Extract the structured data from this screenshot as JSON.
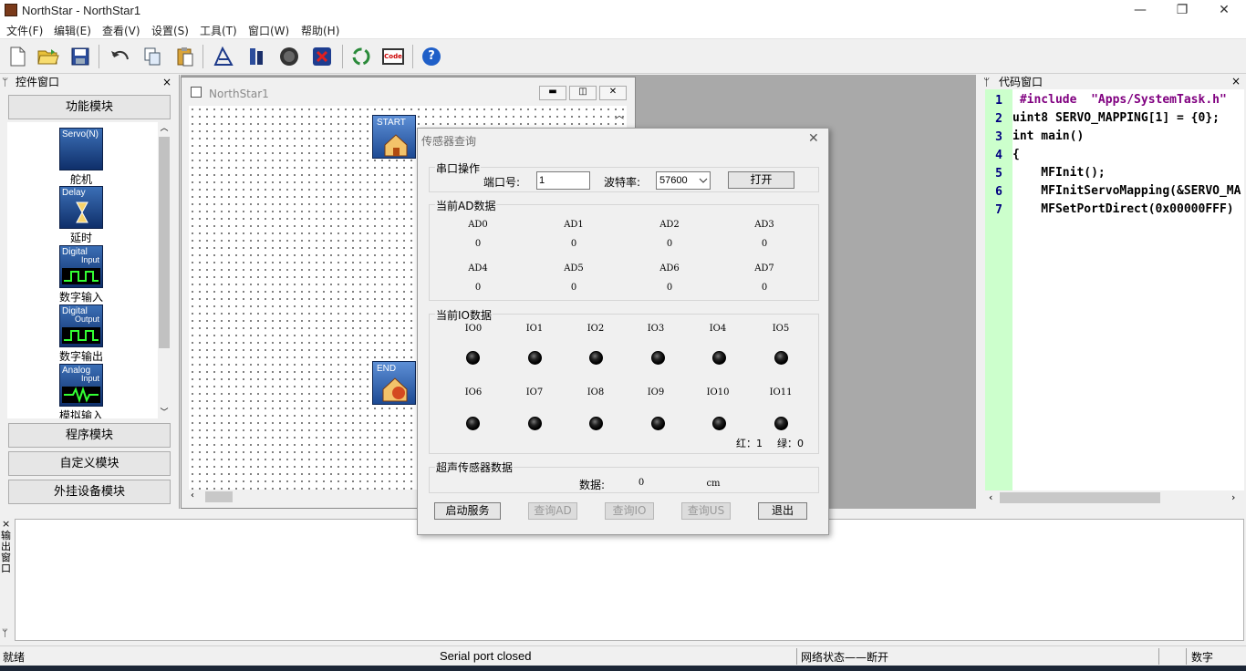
{
  "window": {
    "title": "NorthStar - NorthStar1",
    "minimize": "—",
    "restore": "❐",
    "close": "✕"
  },
  "menu": [
    "文件(F)",
    "编辑(E)",
    "查看(V)",
    "设置(S)",
    "工具(T)",
    "窗口(W)",
    "帮助(H)"
  ],
  "toolbar": {
    "icons": [
      "new-file-icon",
      "open-folder-icon",
      "save-icon",
      "undo-icon",
      "copy-icon",
      "paste-icon",
      "compile-icon",
      "build-icon",
      "run-icon",
      "stop-icon",
      "recycle-icon",
      "code-icon",
      "help-icon"
    ],
    "code_label": "Code",
    "help_label": "?"
  },
  "left_panel": {
    "title": "控件窗口",
    "pin": "ᛘ",
    "close": "×",
    "groups": {
      "function": "功能模块",
      "program": "程序模块",
      "custom": "自定义模块",
      "external": "外挂设备模块"
    },
    "items": [
      {
        "label": "舵机",
        "t1": "Servo(N)",
        "t2": ""
      },
      {
        "label": "延时",
        "t1": "Delay",
        "t2": ""
      },
      {
        "label": "数字输入",
        "t1": "Digital",
        "t2": "Input"
      },
      {
        "label": "数字输出",
        "t1": "Digital",
        "t2": "Output"
      },
      {
        "label": "模拟输入",
        "t1": "Analog",
        "t2": "Input"
      }
    ]
  },
  "child_window": {
    "title": "NorthStar1",
    "start": "START",
    "end": "END"
  },
  "code_panel": {
    "title": "代码窗口",
    "pin": "ᛘ",
    "close": "×",
    "lines": [
      {
        "n": "1",
        "text": " #include  \"Apps/SystemTask.h\""
      },
      {
        "n": "2",
        "text": "uint8 SERVO_MAPPING[1] = {0};"
      },
      {
        "n": "3",
        "text": "int main()"
      },
      {
        "n": "4",
        "text": "{"
      },
      {
        "n": "5",
        "text": "    MFInit();"
      },
      {
        "n": "6",
        "text": "    MFInitServoMapping(&SERVO_MA"
      },
      {
        "n": "7",
        "text": "    MFSetPortDirect(0x00000FFF)"
      }
    ]
  },
  "output_panel": {
    "title": "输出窗口",
    "close": "×",
    "pin": "ᛘ"
  },
  "status": {
    "left": "就绪",
    "serial": "Serial port closed",
    "network": "网络状态——断开",
    "mode": "数字"
  },
  "dialog": {
    "title": "传感器查询",
    "close": "✕",
    "serial": {
      "group": "串口操作",
      "port_label": "端口号:",
      "port_value": "1",
      "baud_label": "波特率:",
      "baud_value": "57600",
      "open_button": "打开"
    },
    "ad": {
      "group": "当前AD数据",
      "labels": [
        "AD0",
        "AD1",
        "AD2",
        "AD3",
        "AD4",
        "AD5",
        "AD6",
        "AD7"
      ],
      "values": [
        "0",
        "0",
        "0",
        "0",
        "0",
        "0",
        "0",
        "0"
      ]
    },
    "io": {
      "group": "当前IO数据",
      "labels": [
        "IO0",
        "IO1",
        "IO2",
        "IO3",
        "IO4",
        "IO5",
        "IO6",
        "IO7",
        "IO8",
        "IO9",
        "IO10",
        "IO11"
      ],
      "red_label": "红：1",
      "green_label": "绿：0"
    },
    "us": {
      "group": "超声传感器数据",
      "data_label": "数据:",
      "data_value": "0",
      "unit": "cm"
    },
    "buttons": {
      "start": "启动服务",
      "query_ad": "查询AD",
      "query_io": "查询IO",
      "query_us": "查询US",
      "exit": "退出"
    }
  }
}
